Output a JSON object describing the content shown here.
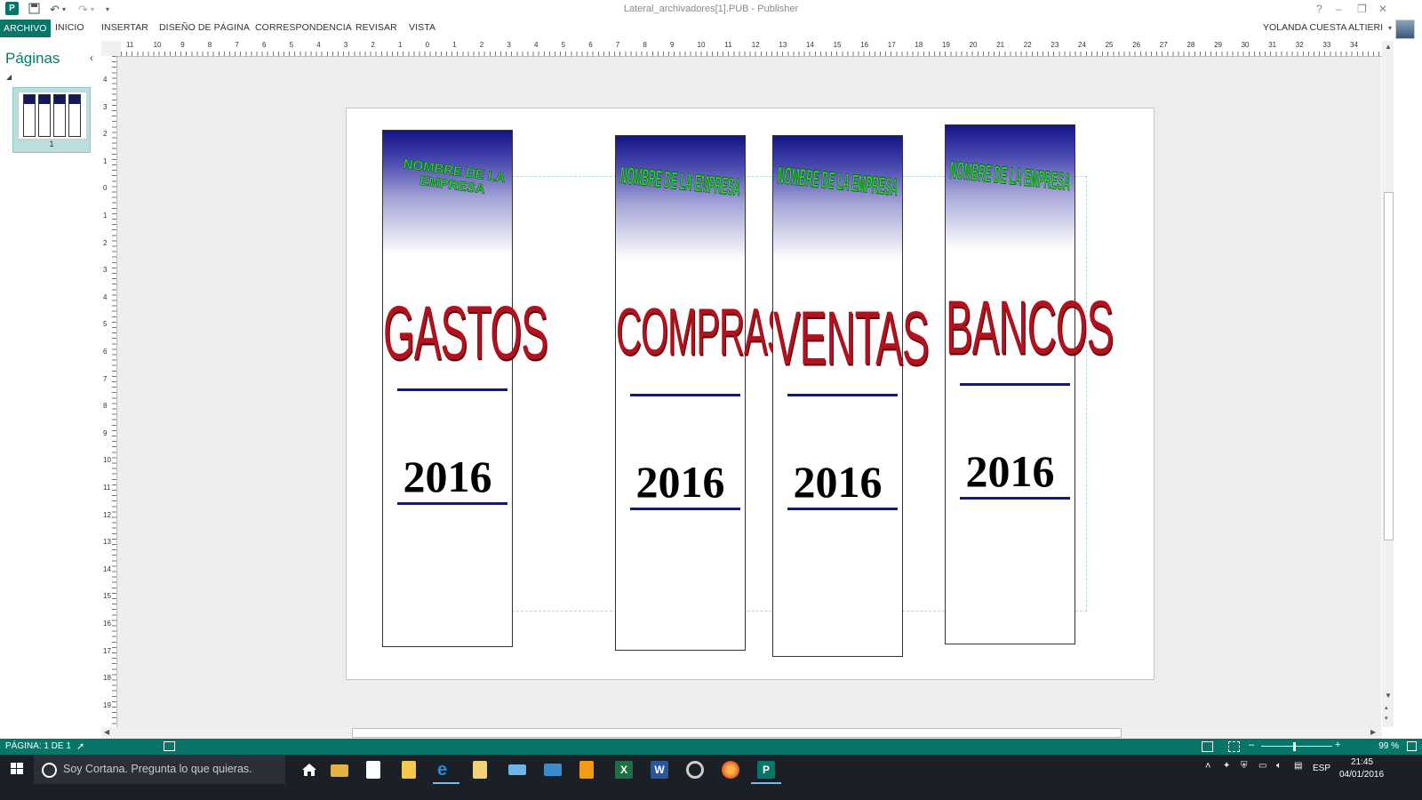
{
  "window": {
    "title": "Lateral_archivadores[1].PUB - Publisher"
  },
  "quick_access": {
    "app_icon": "publisher-icon",
    "save": "save-icon",
    "undo": "undo-icon",
    "redo": "redo-icon",
    "customize": "customize-icon"
  },
  "window_controls": {
    "help": "?",
    "minimize": "–",
    "restore": "❐",
    "close": "✕"
  },
  "ribbon": {
    "tabs": [
      "ARCHIVO",
      "INICIO",
      "INSERTAR",
      "DISEÑO DE PÁGINA",
      "CORRESPONDENCIA",
      "REVISAR",
      "VISTA"
    ],
    "user": "YOLANDA CUESTA ALTIERI"
  },
  "pages_pane": {
    "header": "Páginas",
    "collapse": "‹",
    "page_number": "1"
  },
  "rulers": {
    "horizontal": [
      "11",
      "10",
      "9",
      "8",
      "7",
      "6",
      "5",
      "4",
      "3",
      "2",
      "1",
      "0",
      "1",
      "2",
      "3",
      "4",
      "5",
      "6",
      "7",
      "8",
      "9",
      "10",
      "11",
      "12",
      "13",
      "14",
      "15",
      "16",
      "17",
      "18",
      "19",
      "20",
      "21",
      "22",
      "23",
      "24",
      "25",
      "26",
      "27",
      "28",
      "29",
      "30",
      "31",
      "32",
      "33",
      "34"
    ],
    "vertical": [
      "4",
      "3",
      "2",
      "1",
      "0",
      "1",
      "2",
      "3",
      "4",
      "5",
      "6",
      "7",
      "8",
      "9",
      "10",
      "11",
      "12",
      "13",
      "14",
      "15",
      "16",
      "17",
      "18",
      "19"
    ]
  },
  "document": {
    "spines": [
      {
        "company": "NOMBRE DE LA EMPRESA",
        "label": "GASTOS",
        "year": "2016"
      },
      {
        "company": "NOMBRE DE LA EMPRESA",
        "label": "COMPRAS",
        "year": "2016"
      },
      {
        "company": "NOMBRE DE LA EMPRESA",
        "label": "VENTAS",
        "year": "2016"
      },
      {
        "company": "NOMBRE DE LA EMPRESA",
        "label": "BANCOS",
        "year": "2016"
      }
    ],
    "colors": {
      "header_gradient": "#14148a",
      "label": "#b2121e",
      "company_text": "#35d43f",
      "underline": "#0d1a8a"
    }
  },
  "status_bar": {
    "page": "PÁGINA: 1 DE 1",
    "zoom": "99 %",
    "zoom_minus": "–",
    "zoom_plus": "+"
  },
  "taskbar": {
    "cortana_placeholder": "Soy Cortana. Pregunta lo que quieras.",
    "language": "ESP",
    "time": "21:45",
    "date": "04/01/2016"
  }
}
